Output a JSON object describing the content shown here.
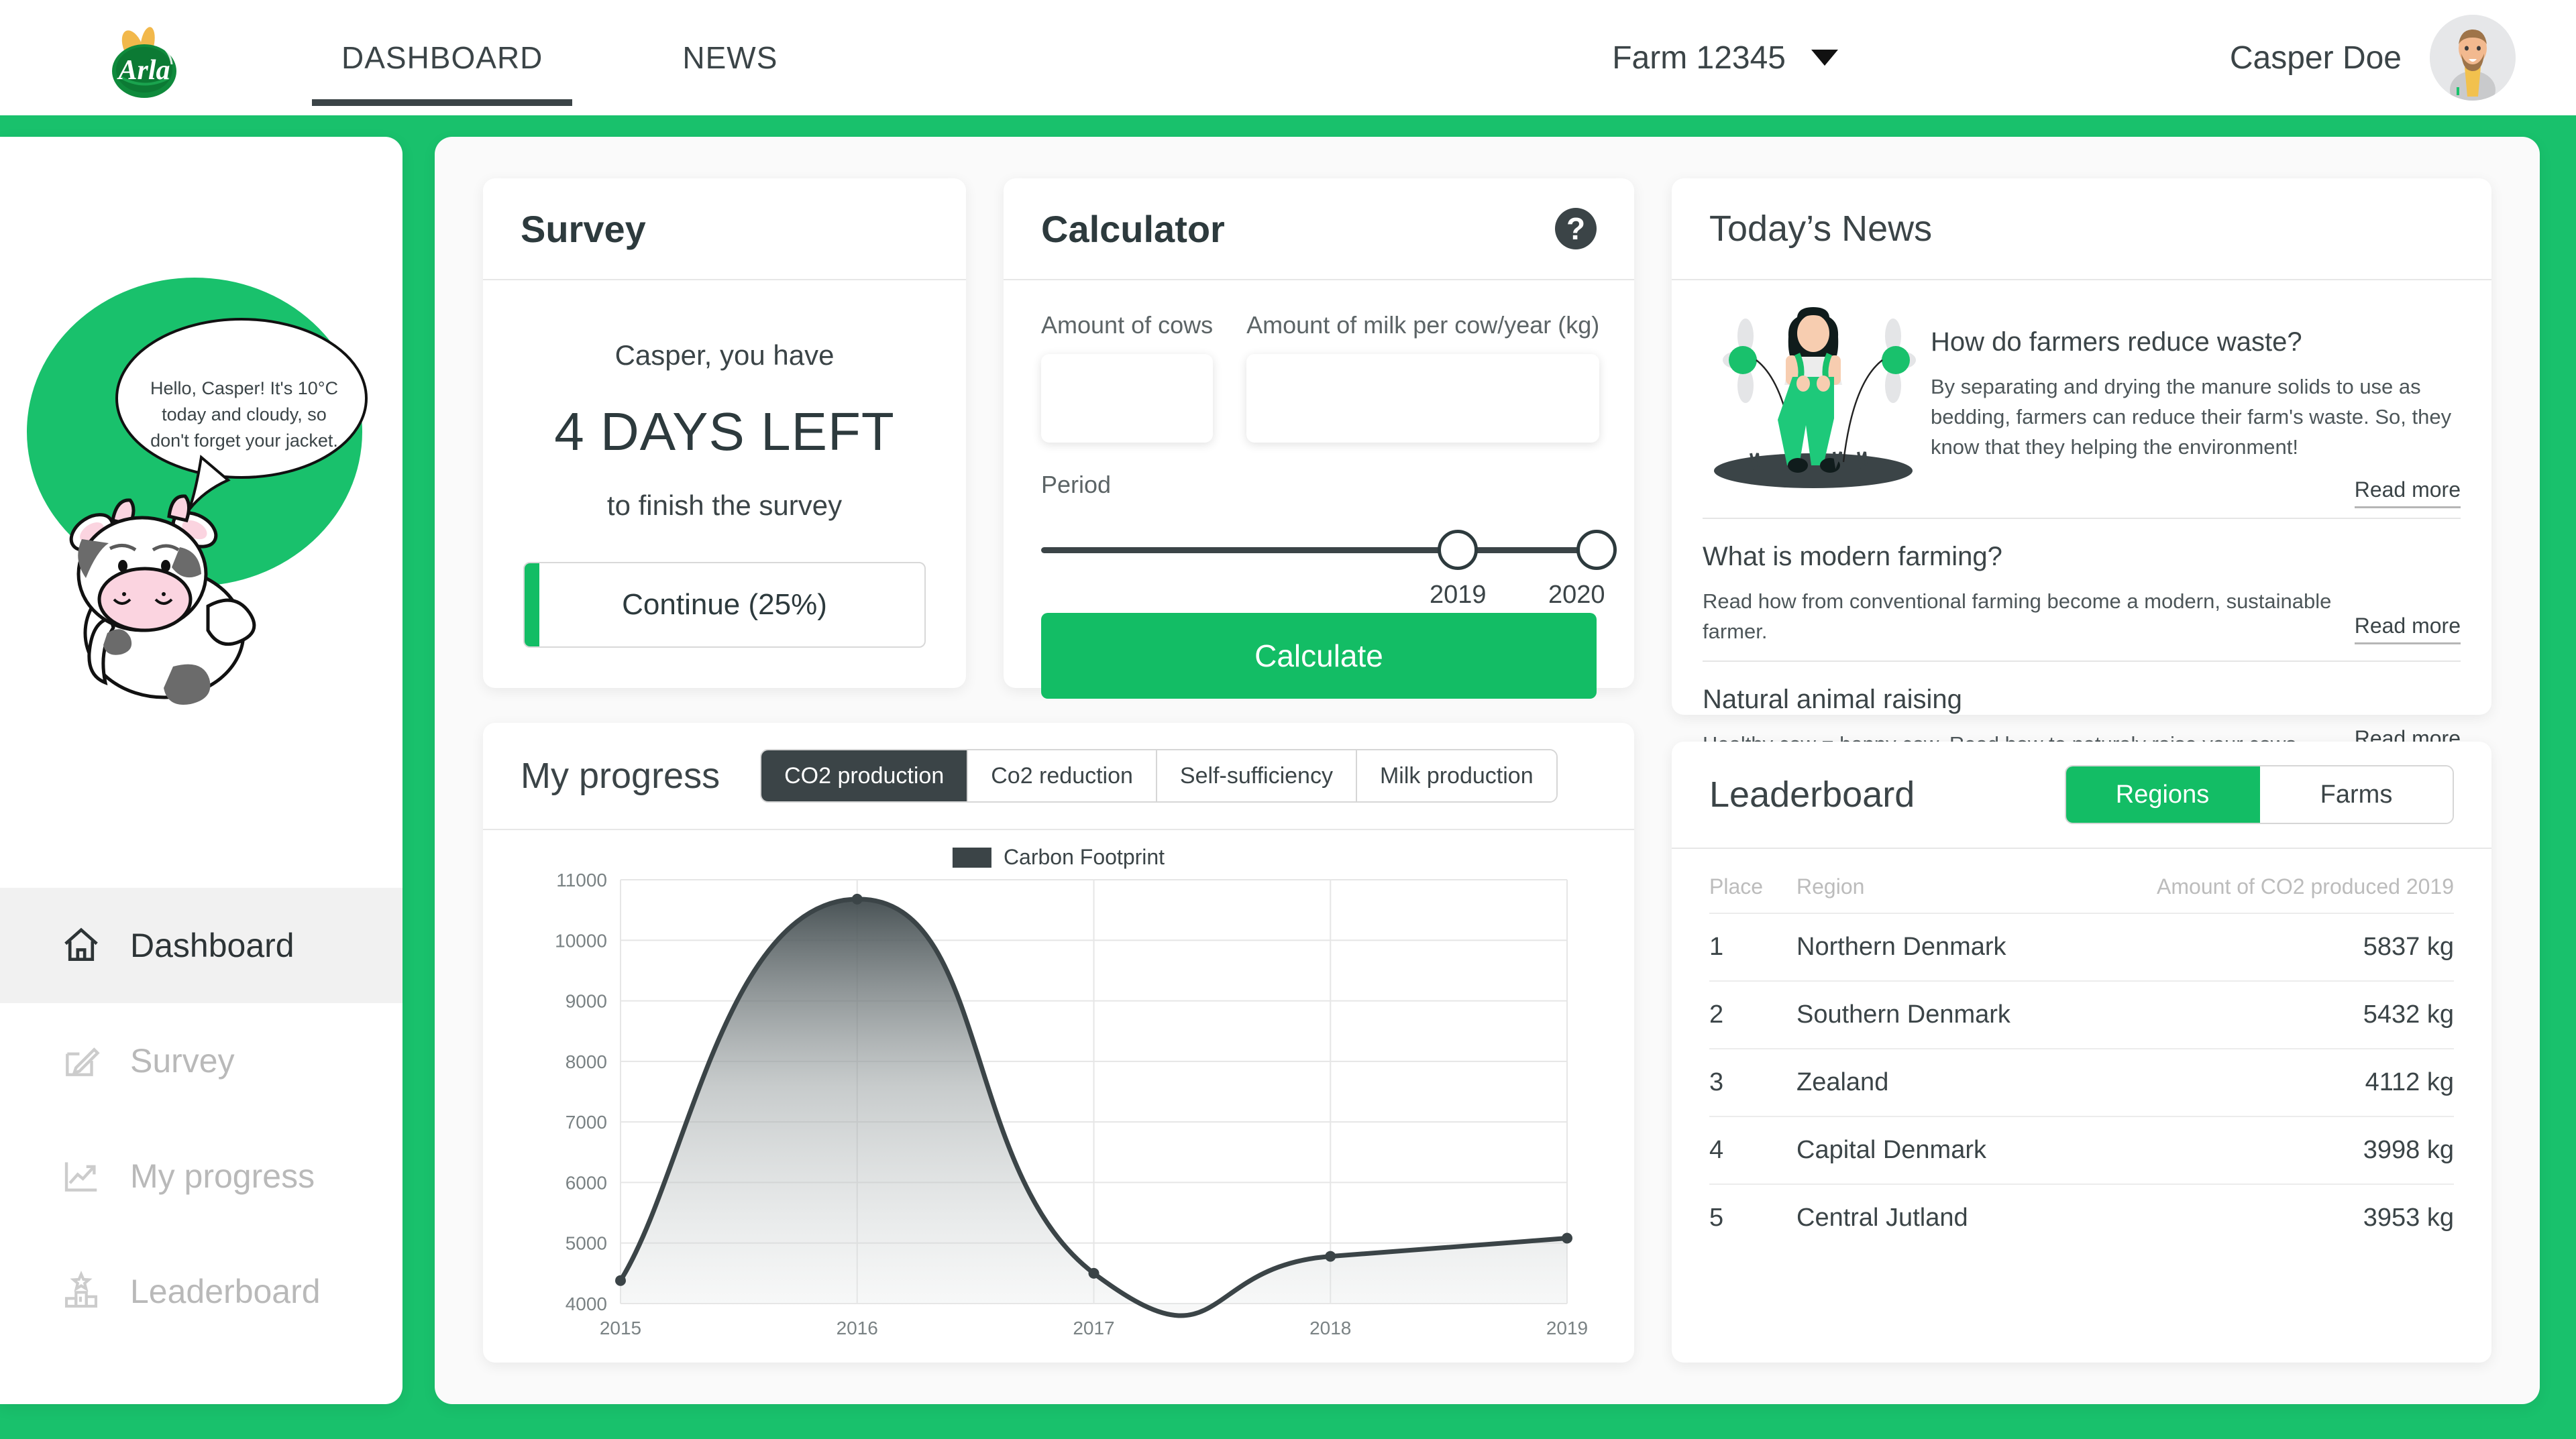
{
  "header": {
    "brand": "Arla",
    "nav": [
      {
        "label": "DASHBOARD",
        "active": true
      },
      {
        "label": "NEWS",
        "active": false
      }
    ],
    "farm_selector": "Farm 12345",
    "user_name": "Casper Doe"
  },
  "sidebar": {
    "mascot_message": "Hello, Casper! It's 10°C today and cloudy, so don't forget your jacket.",
    "items": [
      {
        "label": "Dashboard",
        "icon": "home-icon",
        "active": true
      },
      {
        "label": "Survey",
        "icon": "pencil-edit-icon",
        "active": false
      },
      {
        "label": "My progress",
        "icon": "trend-up-icon",
        "active": false
      },
      {
        "label": "Leaderboard",
        "icon": "podium-icon",
        "active": false
      }
    ]
  },
  "survey": {
    "title": "Survey",
    "line1": "Casper, you have",
    "days_left": "4 DAYS LEFT",
    "line2": "to finish the survey",
    "continue_label": "Continue (25%)",
    "progress_percent": 25
  },
  "calculator": {
    "title": "Calculator",
    "help_icon": "question-mark-icon",
    "cows_label": "Amount of cows",
    "cows_value": "",
    "cows_placeholder": "",
    "milk_label": "Amount of milk per cow/year (kg)",
    "milk_value": "",
    "milk_placeholder": "",
    "period_label": "Period",
    "period_start": "2019",
    "period_end": "2020",
    "calculate_label": "Calculate"
  },
  "progress": {
    "title": "My progress",
    "tabs": [
      {
        "label": "CO2 production",
        "active": true
      },
      {
        "label": "Co2 reduction",
        "active": false
      },
      {
        "label": "Self-sufficiency",
        "active": false
      },
      {
        "label": "Milk production",
        "active": false
      }
    ]
  },
  "chart_data": {
    "type": "area",
    "title": "",
    "legend": [
      "Carbon Footprint"
    ],
    "legend_position": "top-center",
    "series": [
      {
        "name": "Carbon Footprint",
        "values": [
          4380,
          10680,
          4500,
          4780,
          5080
        ]
      }
    ],
    "categories": [
      "2015",
      "2016",
      "2017",
      "2018",
      "2019"
    ],
    "x": [
      2015,
      2016,
      2017,
      2018,
      2019
    ],
    "xlabel": "",
    "ylabel": "",
    "ylim": [
      4000,
      11000
    ],
    "yticks": [
      4000,
      5000,
      6000,
      7000,
      8000,
      9000,
      10000,
      11000
    ],
    "grid": true,
    "line_color": "#3b4447",
    "fill": "gradient-dark-to-light"
  },
  "news": {
    "title": "Today’s News",
    "items": [
      {
        "title": "How do farmers reduce waste?",
        "description": "By separating and drying the manure solids to use as bedding, farmers can reduce their farm's waste. So, they know that they helping the environment!",
        "read_more": "Read more",
        "has_illustration": true
      },
      {
        "title": "What is modern farming?",
        "description": "Read how from conventional farming become a modern, sustainable farmer.",
        "read_more": "Read more",
        "has_illustration": false
      },
      {
        "title": "Natural animal raising",
        "description": "Healthy cow = happy cow. Read how to naturaly raise your cows.",
        "read_more": "Read more",
        "has_illustration": false
      }
    ]
  },
  "leaderboard": {
    "title": "Leaderboard",
    "tabs": [
      {
        "label": "Regions",
        "active": true
      },
      {
        "label": "Farms",
        "active": false
      }
    ],
    "columns": [
      "Place",
      "Region",
      "Amount of CO2 produced 2019"
    ],
    "rows": [
      {
        "place": "1",
        "region": "Northern Denmark",
        "amount": "5837 kg"
      },
      {
        "place": "2",
        "region": "Southern Denmark",
        "amount": "5432 kg"
      },
      {
        "place": "3",
        "region": "Zealand",
        "amount": "4112 kg"
      },
      {
        "place": "4",
        "region": "Capital Denmark",
        "amount": "3998 kg"
      },
      {
        "place": "5",
        "region": "Central Jutland",
        "amount": "3953 kg"
      }
    ]
  },
  "colors": {
    "brand_green": "#19c16c",
    "accent_green": "#13bd65",
    "dark": "#3b4447",
    "page_bg": "#fafafa"
  }
}
